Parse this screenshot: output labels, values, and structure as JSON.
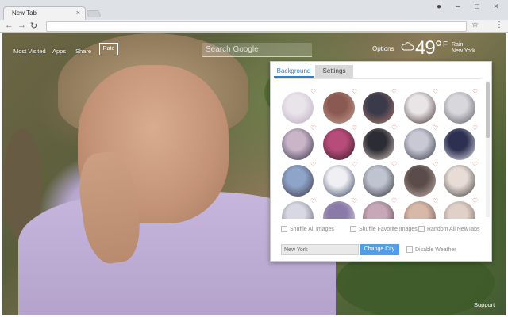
{
  "browser": {
    "tab_title": "New Tab",
    "tab_close": "×",
    "controls": {
      "account": "●",
      "minimize": "–",
      "maximize": "□",
      "close": "×"
    },
    "nav": {
      "back": "←",
      "forward": "→",
      "reload": "↻"
    },
    "address": "",
    "star": "☆",
    "menu": "⋮"
  },
  "topbar": {
    "links": [
      "Most Visited",
      "Apps",
      "Share"
    ],
    "rate_label": "Rate",
    "search_placeholder": "Search Google",
    "options_label": "Options"
  },
  "weather": {
    "temp": "49°",
    "unit": "F",
    "condition": "Rain",
    "city": "New York",
    "icon": "cloud-icon"
  },
  "panel": {
    "tabs": [
      "Background",
      "Settings"
    ],
    "active_tab": "Background",
    "thumbnails": [
      {
        "fav": true
      },
      {
        "fav": true
      },
      {
        "fav": true
      },
      {
        "fav": true
      },
      {
        "fav": true
      },
      {
        "fav": true
      },
      {
        "fav": true
      },
      {
        "fav": true
      },
      {
        "fav": true
      },
      {
        "fav": true
      },
      {
        "fav": true
      },
      {
        "fav": true
      },
      {
        "fav": true
      },
      {
        "fav": true
      },
      {
        "fav": true
      },
      {
        "fav": true
      },
      {
        "fav": true
      },
      {
        "fav": true
      },
      {
        "fav": true
      },
      {
        "fav": true
      }
    ],
    "heart_glyph": "♡",
    "options": [
      "Shuffle All Images",
      "Shuffle Favorite Images",
      "Random All NewTabs"
    ],
    "city_value": "New York",
    "change_city_label": "Change City",
    "disable_weather_label": "Disable Weather"
  },
  "support_label": "Support",
  "colors": {
    "accent": "#4f9ee9",
    "tab_active": "#2a7fd4",
    "heart": "#e6543a"
  }
}
